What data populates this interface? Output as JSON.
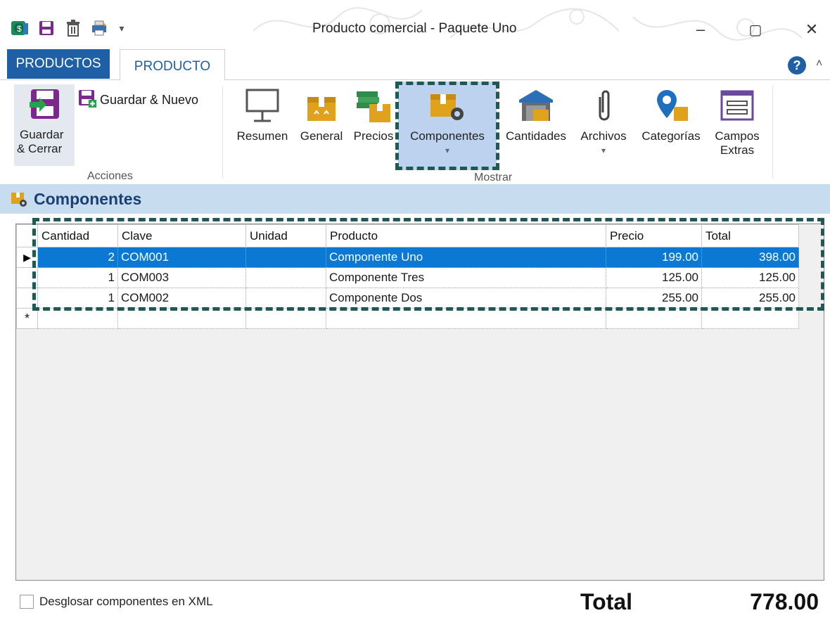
{
  "window": {
    "title": "Producto comercial - Paquete Uno",
    "minimize": "–",
    "maximize": "▢",
    "close": "✕"
  },
  "tabs": {
    "file": "PRODUCTOS",
    "active": "PRODUCTO"
  },
  "ribbon": {
    "save_close": "Guardar\n& Cerrar",
    "save_close_l1": "Guardar",
    "save_close_l2": "& Cerrar",
    "save_new": "Guardar & Nuevo",
    "group_acciones": "Acciones",
    "group_mostrar": "Mostrar",
    "resumen": "Resumen",
    "general": "General",
    "precios": "Precios",
    "componentes": "Componentes",
    "cantidades": "Cantidades",
    "archivos": "Archivos",
    "categorias": "Categorías",
    "campos_l1": "Campos",
    "campos_l2": "Extras"
  },
  "section": {
    "title": "Componentes"
  },
  "grid": {
    "columns": [
      "Cantidad",
      "Clave",
      "Unidad",
      "Producto",
      "Precio",
      "Total"
    ],
    "rows": [
      {
        "cantidad": "2",
        "clave": "COM001",
        "unidad": "",
        "producto": "Componente Uno",
        "precio": "199.00",
        "total": "398.00"
      },
      {
        "cantidad": "1",
        "clave": "COM003",
        "unidad": "",
        "producto": "Componente Tres",
        "precio": "125.00",
        "total": "125.00"
      },
      {
        "cantidad": "1",
        "clave": "COM002",
        "unidad": "",
        "producto": "Componente Dos",
        "precio": "255.00",
        "total": "255.00"
      }
    ],
    "new_row_marker": "*",
    "current_row_marker": "▶"
  },
  "footer": {
    "checkbox_label": "Desglosar componentes en XML",
    "total_label": "Total",
    "total_value": "778.00"
  },
  "colors": {
    "accent": "#1f5fa6",
    "selection": "#0b78d4",
    "section_bg": "#c8dcf0",
    "highlight_border": "#1f5956"
  }
}
